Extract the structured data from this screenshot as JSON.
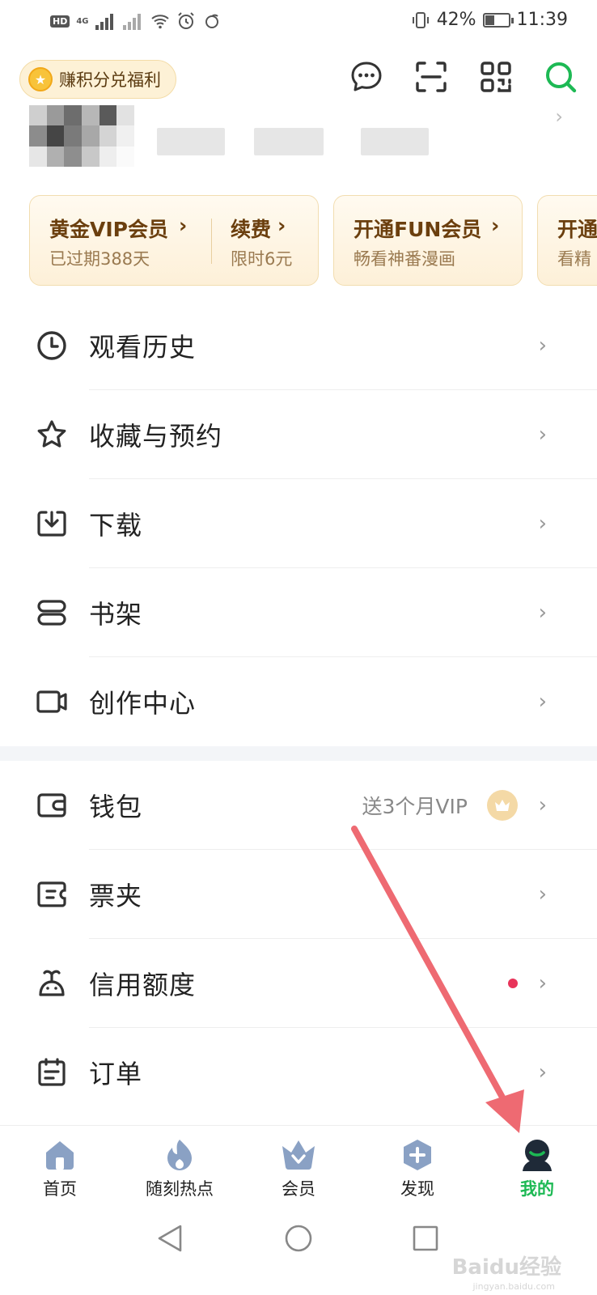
{
  "status_bar": {
    "left_badge": "HD",
    "network": "4G",
    "battery_percent_label": "42%",
    "battery_level": 0.42,
    "time": "11:39"
  },
  "header": {
    "points_label": "赚积分兑福利",
    "icons": [
      "message-icon",
      "scan-icon",
      "qrcode-icon",
      "search-icon"
    ]
  },
  "vip_cards": [
    {
      "title": "黄金VIP会员",
      "sub": "已过期388天",
      "title2": "续费",
      "sub2": "限时6元"
    },
    {
      "title": "开通FUN会员",
      "sub": "畅看神番漫画"
    },
    {
      "title": "开通",
      "sub": "看精"
    }
  ],
  "menu_group1": [
    {
      "label": "观看历史",
      "icon": "clock-icon"
    },
    {
      "label": "收藏与预约",
      "icon": "star-icon"
    },
    {
      "label": "下载",
      "icon": "download-icon"
    },
    {
      "label": "书架",
      "icon": "bookshelf-icon"
    },
    {
      "label": "创作中心",
      "icon": "camera-icon"
    }
  ],
  "menu_group2": [
    {
      "label": "钱包",
      "icon": "wallet-icon",
      "note": "送3个月VIP"
    },
    {
      "label": "票夹",
      "icon": "ticket-icon"
    },
    {
      "label": "信用额度",
      "icon": "credit-icon"
    },
    {
      "label": "订单",
      "icon": "order-icon"
    }
  ],
  "chevron": "›",
  "bottom_nav": [
    {
      "label": "首页",
      "icon": "home-icon"
    },
    {
      "label": "随刻热点",
      "icon": "flame-icon"
    },
    {
      "label": "会员",
      "icon": "crown-icon"
    },
    {
      "label": "发现",
      "icon": "discover-icon"
    },
    {
      "label": "我的",
      "icon": "profile-icon",
      "active": true
    }
  ],
  "watermark": "Baidu经验",
  "watermark_sub": "jingyan.baidu.com",
  "colors": {
    "accent": "#1db954",
    "arrow": "#ee6a72",
    "vip_text": "#6b3f0e",
    "red_dot": "#e8345a"
  }
}
